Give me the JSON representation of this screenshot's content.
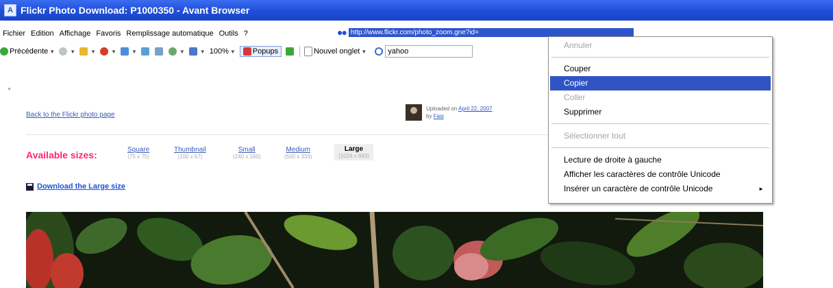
{
  "window": {
    "title": "Flickr Photo Download: P1000350 - Avant Browser"
  },
  "menu": [
    "Fichier",
    "Edition",
    "Affichage",
    "Favoris",
    "Remplissage automatique",
    "Outils",
    "?"
  ],
  "address": {
    "url_selected": "http://www.flickr.com/photo_zoom.gne?id="
  },
  "toolbar": {
    "back_label": "Précédente",
    "zoom_label": "100%",
    "popups_label": "Popups",
    "new_tab_label": "Nouvel onglet",
    "search_value": "yahoo"
  },
  "page": {
    "back_link": "Back to the Flickr photo page",
    "uploaded_prefix": "Uploaded on",
    "uploaded_date": "April 22, 2007",
    "by_prefix": "by",
    "by_user": "Fasi",
    "available_sizes_label": "Available sizes:",
    "sizes": [
      {
        "name": "Square",
        "dims": "(75 x 75)"
      },
      {
        "name": "Thumbnail",
        "dims": "(100 x 67)"
      },
      {
        "name": "Small",
        "dims": "(240 x 160)"
      },
      {
        "name": "Medium",
        "dims": "(500 x 333)"
      },
      {
        "name": "Large",
        "dims": "(1024 x 683)"
      }
    ],
    "download_label": "Download the Large size"
  },
  "context_menu": {
    "items": [
      {
        "label": "Annuler",
        "enabled": false
      },
      {
        "label": "Couper",
        "enabled": true
      },
      {
        "label": "Copier",
        "enabled": true,
        "highlighted": true
      },
      {
        "label": "Coller",
        "enabled": false
      },
      {
        "label": "Supprimer",
        "enabled": true
      },
      {
        "label": "Sélectionner tout",
        "enabled": false
      },
      {
        "label": "Lecture de droite à gauche",
        "enabled": true
      },
      {
        "label": "Afficher les caractères de contrôle Unicode",
        "enabled": true
      },
      {
        "label": "Insérer un caractère de contrôle Unicode",
        "enabled": true,
        "submenu": true
      }
    ]
  },
  "colors": {
    "title_bar": "#1f4ed8",
    "selection": "#3154c4",
    "sizes_label": "#ff2673",
    "link": "#3b5cb5"
  }
}
